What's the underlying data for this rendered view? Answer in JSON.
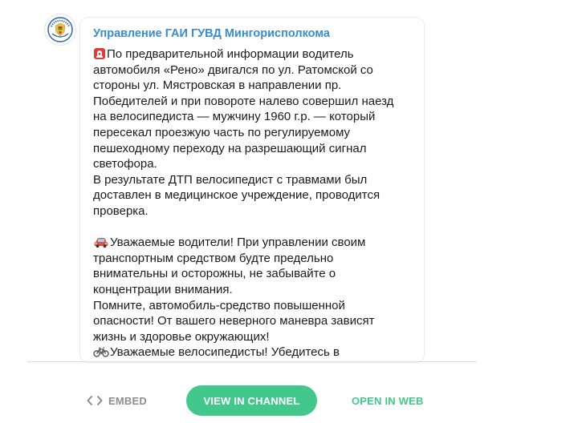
{
  "post": {
    "channel_name": "Управление ГАИ ГУВД Мингорисполкома",
    "avatar_icon": "gai-emblem-icon",
    "lines": [
      {
        "emoji": "police-light-icon",
        "text": "По предварительной информации водитель"
      },
      {
        "text": "автомобиля «Рено» двигался по ул. Ратомской со"
      },
      {
        "text": "стороны ул. Мястровская в направлении пр."
      },
      {
        "text": "Победителей и при повороте налево совершил наезд"
      },
      {
        "text": "на велосипедиста — мужчину 1960 г.р. — который"
      },
      {
        "text": "пересекал проезжую часть по регулируемому"
      },
      {
        "text": "пешеходному переходу на разрешающий сигнал"
      },
      {
        "text": "светофора."
      },
      {
        "text": "В результате ДТП велосипедист с травмами был"
      },
      {
        "text": "доставлен в медицинское учреждение, проводится"
      },
      {
        "text": "проверка."
      },
      {
        "blank": true
      },
      {
        "emoji": "car-icon",
        "text": "Уважаемые водители! При управлении своим"
      },
      {
        "text": "транспортным средством будте предельно"
      },
      {
        "text": "внимательны и осторожны, не забывайте о"
      },
      {
        "text": "концентрации внимания."
      },
      {
        "text": "Помните, автомобиль-средство повышенной"
      },
      {
        "text": "опасности! От вашего неверного маневра зависят"
      },
      {
        "text": "жизнь и здоровье окружающих!"
      },
      {
        "emoji": "bicycle-icon",
        "text": "Уважаемые велосипедисты! Убедитесь в"
      }
    ]
  },
  "footer": {
    "embed_label": "EMBED",
    "embed_icon": "code-brackets-icon",
    "view_label": "VIEW IN CHANNEL",
    "open_label": "OPEN IN WEB"
  },
  "colors": {
    "channel_name": "#3a8cc7",
    "accent_green": "#43c88b",
    "embed_gray": "#8a8e93",
    "text": "#1a1a1a"
  }
}
